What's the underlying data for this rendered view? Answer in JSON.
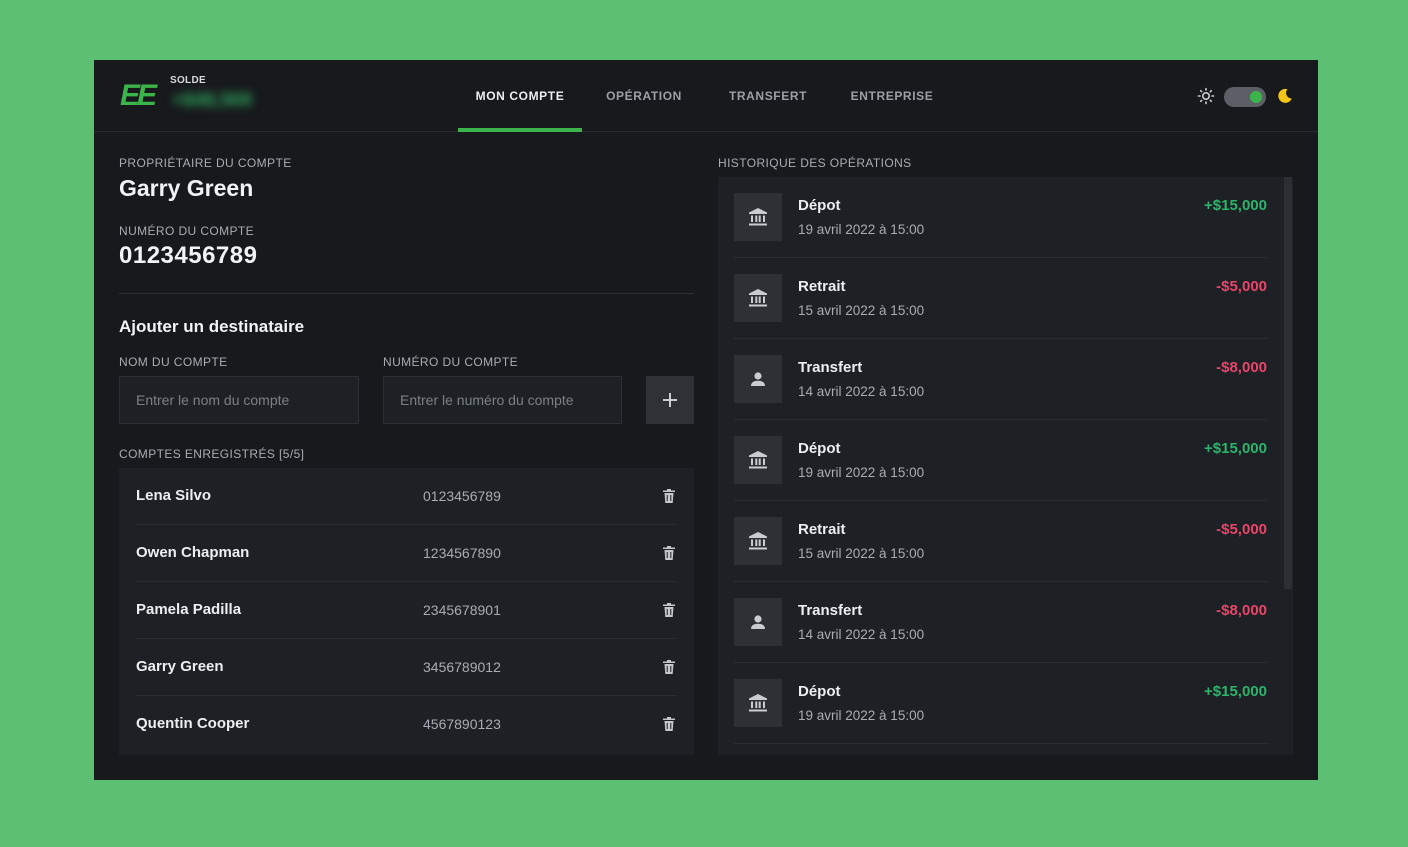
{
  "header": {
    "logo": "EE",
    "balance_label": "SOLDE",
    "balance_value": "+$48,569",
    "tabs": [
      {
        "label": "MON COMPTE",
        "active": true
      },
      {
        "label": "OPÉRATION",
        "active": false
      },
      {
        "label": "TRANSFERT",
        "active": false
      },
      {
        "label": "ENTREPRISE",
        "active": false
      }
    ],
    "theme": {
      "dark_mode": true,
      "toggle_color": "#3bb54a",
      "moon_color": "#f5c518"
    }
  },
  "account": {
    "owner_label": "PROPRIÉTAIRE DU COMPTE",
    "owner_name": "Garry Green",
    "number_label": "NUMÉRO DU COMPTE",
    "number": "0123456789"
  },
  "add_recipient": {
    "title": "Ajouter un destinataire",
    "name_label": "NOM DU COMPTE",
    "name_placeholder": "Entrer le nom du compte",
    "number_label": "NUMÉRO DU COMPTE",
    "number_placeholder": "Entrer le numéro du compte"
  },
  "saved_accounts": {
    "label": "COMPTES ENREGISTRÉS [5/5]",
    "items": [
      {
        "name": "Lena Silvo",
        "number": "0123456789"
      },
      {
        "name": "Owen Chapman",
        "number": "1234567890"
      },
      {
        "name": "Pamela Padilla",
        "number": "2345678901"
      },
      {
        "name": "Garry Green",
        "number": "3456789012"
      },
      {
        "name": "Quentin Cooper",
        "number": "4567890123"
      }
    ]
  },
  "history": {
    "label": "HISTORIQUE DES OPÉRATIONS",
    "items": [
      {
        "title": "Dépot",
        "date": "19 avril 2022 à 15:00",
        "amount": "+$15,000",
        "kind": "bank",
        "positive": true
      },
      {
        "title": "Retrait",
        "date": "15 avril 2022 à 15:00",
        "amount": "-$5,000",
        "kind": "bank",
        "positive": false
      },
      {
        "title": "Transfert",
        "date": "14 avril 2022 à 15:00",
        "amount": "-$8,000",
        "kind": "person",
        "positive": false
      },
      {
        "title": "Dépot",
        "date": "19 avril 2022 à 15:00",
        "amount": "+$15,000",
        "kind": "bank",
        "positive": true
      },
      {
        "title": "Retrait",
        "date": "15 avril 2022 à 15:00",
        "amount": "-$5,000",
        "kind": "bank",
        "positive": false
      },
      {
        "title": "Transfert",
        "date": "14 avril 2022 à 15:00",
        "amount": "-$8,000",
        "kind": "person",
        "positive": false
      },
      {
        "title": "Dépot",
        "date": "19 avril 2022 à 15:00",
        "amount": "+$15,000",
        "kind": "bank",
        "positive": true
      }
    ]
  },
  "colors": {
    "accent": "#3bb54a",
    "positive": "#2db36b",
    "negative": "#e8456a"
  }
}
